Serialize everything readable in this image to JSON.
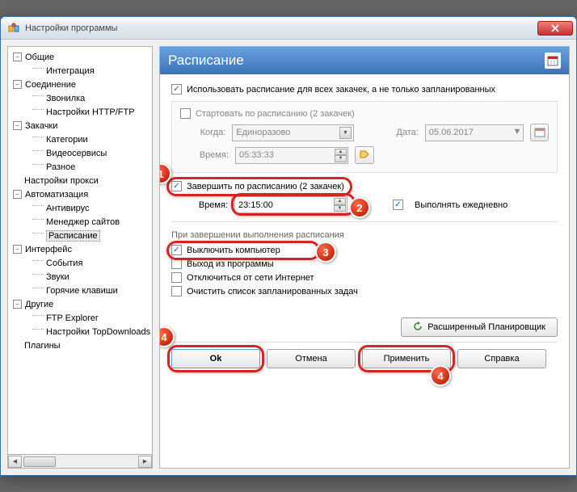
{
  "window": {
    "title": "Настройки программы"
  },
  "tree": {
    "n0": "Общие",
    "n0_0": "Интеграция",
    "n1": "Соединение",
    "n1_0": "Звонилка",
    "n1_1": "Настройки HTTP/FTP",
    "n2": "Закачки",
    "n2_0": "Категории",
    "n2_1": "Видеосервисы",
    "n2_2": "Разное",
    "n3": "Настройки прокси",
    "n4": "Автоматизация",
    "n4_0": "Антивирус",
    "n4_1": "Менеджер сайтов",
    "n4_2": "Расписание",
    "n5": "Интерфейс",
    "n5_0": "События",
    "n5_1": "Звуки",
    "n5_2": "Горячие клавиши",
    "n6": "Другие",
    "n6_0": "FTP Explorer",
    "n6_1": "Настройки TopDownloads",
    "n7": "Плагины"
  },
  "panel": {
    "title": "Расписание",
    "use_schedule_all": "Использовать расписание для всех закачек, а не только запланированных",
    "start": {
      "label": "Стартовать по расписанию  (2 закачек)",
      "when_lbl": "Когда:",
      "when_val": "Единоразово",
      "date_lbl": "Дата:",
      "date_val": "05.06.2017",
      "time_lbl": "Время:",
      "time_val": "05:33:33"
    },
    "finish": {
      "label": "Завершить по расписанию  (2 закачек)",
      "time_lbl": "Время:",
      "time_val": "23:15:00",
      "daily": "Выполнять ежедневно"
    },
    "on_finish": {
      "title": "При завершении выполнения расписания",
      "shutdown": "Выключить компьютер",
      "exit": "Выход из программы",
      "disconnect": "Отключиться от сети Интернет",
      "clear": "Очистить список запланированных задач"
    },
    "adv_btn": "Расширенный Планировщик",
    "buttons": {
      "ok": "Ok",
      "cancel": "Отмена",
      "apply": "Применить",
      "help": "Справка"
    }
  },
  "badges": {
    "b1": "1",
    "b2": "2",
    "b3": "3",
    "b4": "4"
  }
}
